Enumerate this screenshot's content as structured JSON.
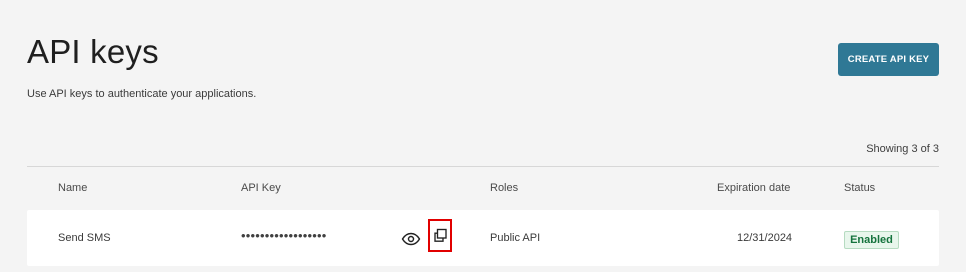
{
  "page": {
    "title": "API keys",
    "subtitle": "Use API keys to authenticate your applications.",
    "create_button_label": "CREATE API KEY",
    "showing_text": "Showing 3 of 3"
  },
  "table": {
    "columns": [
      "Name",
      "API Key",
      "Roles",
      "Expiration date",
      "Status"
    ],
    "rows": [
      {
        "name": "Send SMS",
        "api_key_masked": "••••••••••••••••••",
        "role": "Public API",
        "expiration_date": "12/31/2024",
        "status": "Enabled"
      }
    ]
  },
  "icons": {
    "show_key": "eye-icon",
    "copy_key": "copy-icon"
  },
  "colors": {
    "accent": "#2f7895",
    "highlight": "#e10000",
    "success": "#15733d"
  }
}
